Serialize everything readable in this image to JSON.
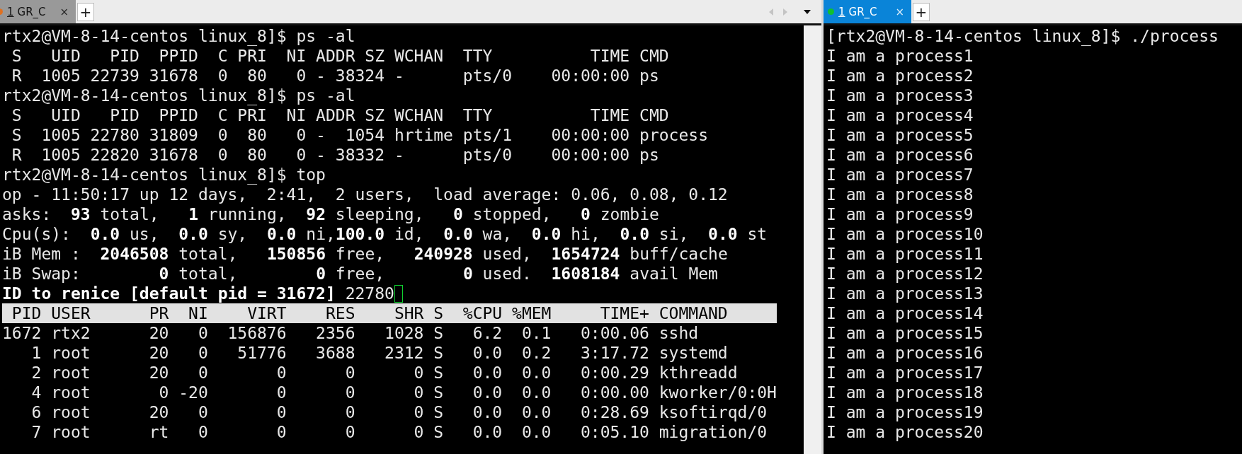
{
  "left_pane": {
    "tabs": [
      {
        "number": "1",
        "name": "GR_C",
        "close": "×",
        "selected": false,
        "color": "#e07020"
      }
    ],
    "new_tab": "+",
    "lines": [
      {
        "kind": "plain",
        "text": "rtx2@VM-8-14-centos linux_8]$ ps -al"
      },
      {
        "kind": "plain",
        "text": " S   UID   PID  PPID  C PRI  NI ADDR SZ WCHAN  TTY          TIME CMD"
      },
      {
        "kind": "plain",
        "text": " R  1005 22739 31678  0  80   0 - 38324 -      pts/0    00:00:00 ps"
      },
      {
        "kind": "plain",
        "text": "rtx2@VM-8-14-centos linux_8]$ ps -al"
      },
      {
        "kind": "plain",
        "text": " S   UID   PID  PPID  C PRI  NI ADDR SZ WCHAN  TTY          TIME CMD"
      },
      {
        "kind": "plain",
        "text": " S  1005 22780 31809  0  80   0 -  1054 hrtime pts/1    00:00:00 process"
      },
      {
        "kind": "plain",
        "text": " R  1005 22820 31678  0  80   0 - 38332 -      pts/0    00:00:00 ps"
      },
      {
        "kind": "plain",
        "text": "rtx2@VM-8-14-centos linux_8]$ top"
      },
      {
        "kind": "plain",
        "text": "op - 11:50:17 up 12 days,  2:41,  2 users,  load average: 0.06, 0.08, 0.12"
      },
      {
        "kind": "plain",
        "text": "asks:  **93** total,   **1** running,  **92** sleeping,   **0** stopped,   **0** zombie"
      },
      {
        "kind": "plain",
        "text": "Cpu(s):  **0.0** us,  **0.0** sy,  **0.0** ni,**100.0** id,  **0.0** wa,  **0.0** hi,  **0.0** si,  **0.0** st"
      },
      {
        "kind": "plain",
        "text": "iB Mem :  **2046508** total,   **150856** free,   **240928** used,  **1654724** buff/cache"
      },
      {
        "kind": "plain",
        "text": "iB Swap:        **0** total,        **0** free,        **0** used.  **1608184** avail Mem"
      },
      {
        "kind": "input",
        "text": "**ID to renice [default pid = 31672]** 22780"
      },
      {
        "kind": "header",
        "text": " PID USER      PR  NI    VIRT    RES    SHR S  %CPU %MEM     TIME+ COMMAND"
      },
      {
        "kind": "plain",
        "text": "1672 rtx2      20   0  156876   2356   1028 S   6.2  0.1   0:00.06 sshd"
      },
      {
        "kind": "plain",
        "text": "   1 root      20   0   51776   3688   2312 S   0.0  0.2   3:17.72 systemd"
      },
      {
        "kind": "plain",
        "text": "   2 root      20   0       0      0      0 S   0.0  0.0   0:00.29 kthreadd"
      },
      {
        "kind": "plain",
        "text": "   4 root       0 -20       0      0      0 S   0.0  0.0   0:00.00 kworker/0:0H"
      },
      {
        "kind": "plain",
        "text": "   6 root      20   0       0      0      0 S   0.0  0.0   0:28.69 ksoftirqd/0"
      },
      {
        "kind": "plain",
        "text": "   7 root      rt   0       0      0      0 S   0.0  0.0   0:05.10 migration/0"
      }
    ]
  },
  "right_pane": {
    "tabs": [
      {
        "number": "1",
        "name": "GR_C",
        "close": "×",
        "selected": true,
        "color": "#10c030"
      }
    ],
    "new_tab": "+",
    "lines": [
      {
        "text": "[rtx2@VM-8-14-centos linux_8]$ ./process"
      },
      {
        "text": "I am a process1"
      },
      {
        "text": "I am a process2"
      },
      {
        "text": "I am a process3"
      },
      {
        "text": "I am a process4"
      },
      {
        "text": "I am a process5"
      },
      {
        "text": "I am a process6"
      },
      {
        "text": "I am a process7"
      },
      {
        "text": "I am a process8"
      },
      {
        "text": "I am a process9"
      },
      {
        "text": "I am a process10"
      },
      {
        "text": "I am a process11"
      },
      {
        "text": "I am a process12"
      },
      {
        "text": "I am a process13"
      },
      {
        "text": "I am a process14"
      },
      {
        "text": "I am a process15"
      },
      {
        "text": "I am a process16"
      },
      {
        "text": "I am a process17"
      },
      {
        "text": "I am a process18"
      },
      {
        "text": "I am a process19"
      },
      {
        "text": "I am a process20"
      }
    ]
  }
}
